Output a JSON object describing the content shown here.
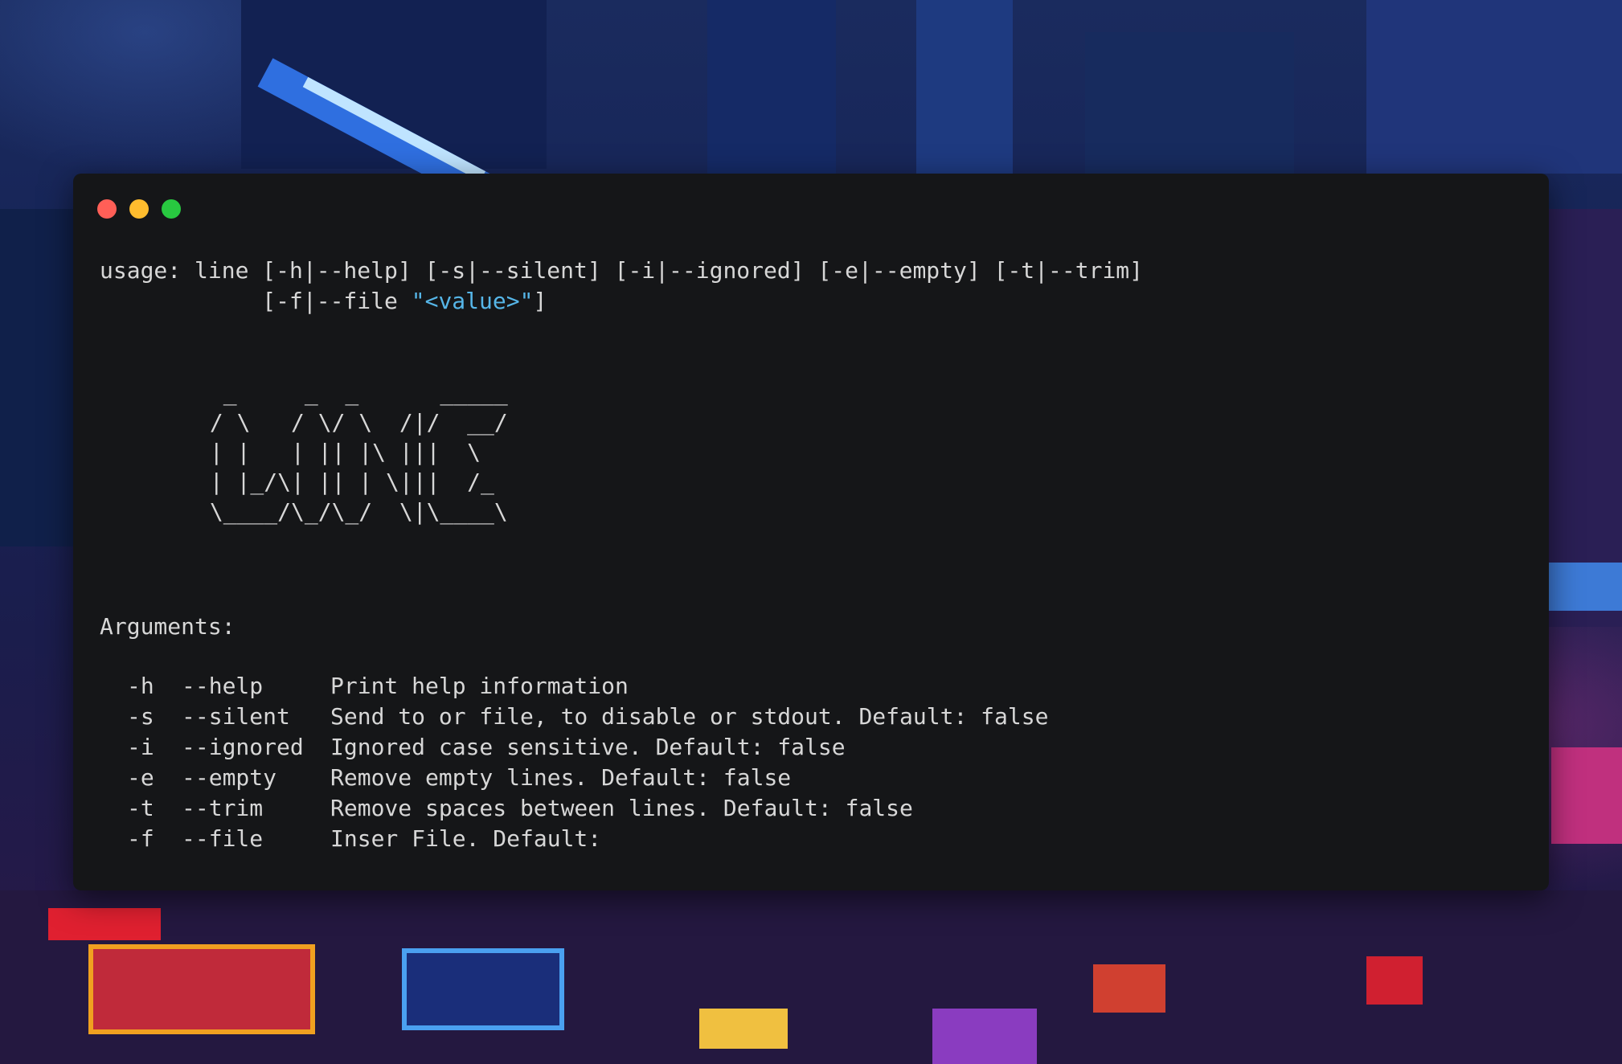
{
  "window": {
    "controls": [
      {
        "name": "close",
        "color": "#ff5f57"
      },
      {
        "name": "minimize",
        "color": "#febc2e"
      },
      {
        "name": "zoom",
        "color": "#28c840"
      }
    ]
  },
  "usage": {
    "line1": "usage: line [-h|--help] [-s|--silent] [-i|--ignored] [-e|--empty] [-t|--trim]",
    "line2_prefix": "            [-f|--file ",
    "line2_value": "\"<value>\"",
    "line2_suffix": "]"
  },
  "ascii_art": "  _     _  _      _____\n / \\   / \\/ \\  /|/  __/\n | |   | || |\\ |||  \\\n | |_/\\| || | \\|||  /_\n \\____/\\_/\\_/  \\|\\____\\",
  "arguments": {
    "heading": "Arguments:",
    "items": [
      {
        "short": "-h",
        "long": "--help",
        "desc": "Print help information"
      },
      {
        "short": "-s",
        "long": "--silent",
        "desc": "Send to or file, to disable or stdout. Default: false"
      },
      {
        "short": "-i",
        "long": "--ignored",
        "desc": "Ignored case sensitive. Default: false"
      },
      {
        "short": "-e",
        "long": "--empty",
        "desc": "Remove empty lines. Default: false"
      },
      {
        "short": "-t",
        "long": "--trim",
        "desc": "Remove spaces between lines. Default: false"
      },
      {
        "short": "-f",
        "long": "--file",
        "desc": "Inser File. Default:"
      }
    ]
  },
  "colors": {
    "terminal_bg": "#151618",
    "text": "#d7d7d7",
    "string": "#56b6e8"
  }
}
